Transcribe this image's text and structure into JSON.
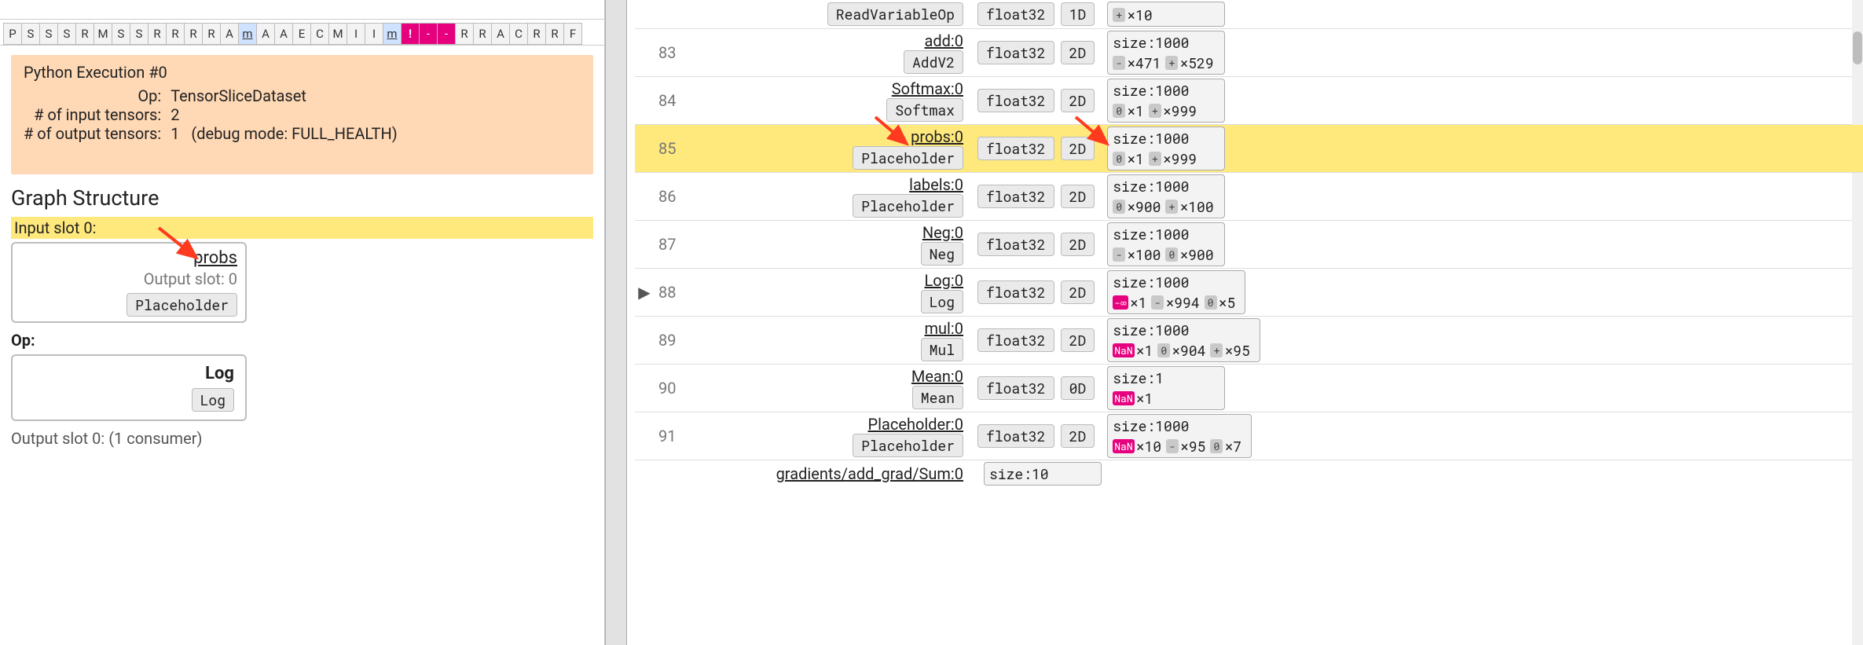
{
  "timeline": {
    "cells": [
      {
        "t": "P"
      },
      {
        "t": "S"
      },
      {
        "t": "S"
      },
      {
        "t": "S"
      },
      {
        "t": "R"
      },
      {
        "t": "M"
      },
      {
        "t": "S"
      },
      {
        "t": "S"
      },
      {
        "t": "R"
      },
      {
        "t": "R"
      },
      {
        "t": "R"
      },
      {
        "t": "R"
      },
      {
        "t": "A"
      },
      {
        "t": "m",
        "cls": "mtype"
      },
      {
        "t": "A"
      },
      {
        "t": "A"
      },
      {
        "t": "E"
      },
      {
        "t": "C"
      },
      {
        "t": "M"
      },
      {
        "t": "I"
      },
      {
        "t": "I"
      },
      {
        "t": "m",
        "cls": "mtype"
      },
      {
        "t": "!",
        "cls": "bang"
      },
      {
        "t": "-",
        "cls": "bang-minus"
      },
      {
        "t": "-",
        "cls": "bang-minus"
      },
      {
        "t": "R"
      },
      {
        "t": "R"
      },
      {
        "t": "A"
      },
      {
        "t": "C"
      },
      {
        "t": "R"
      },
      {
        "t": "R"
      },
      {
        "t": "F"
      }
    ]
  },
  "exec_card": {
    "title": "Python Execution #0",
    "op_label": "Op:",
    "op_value": "TensorSliceDataset",
    "in_label": "# of input tensors:",
    "in_value": "2",
    "out_label": "# of output tensors:",
    "out_value": "1",
    "debug_text": "(debug mode: FULL_HEALTH)"
  },
  "graph": {
    "title": "Graph Structure",
    "input_slot_label": "Input slot 0:",
    "probs_link": "probs",
    "probs_sub": "Output slot: 0",
    "placeholder_chip": "Placeholder",
    "op_label": "Op:",
    "op_name": "Log",
    "op_chip": "Log",
    "output_slot_line": "Output slot 0: (1 consumer)"
  },
  "rows": [
    {
      "idx": "",
      "name": "",
      "kind": "ReadVariableOp",
      "dtype": "float32",
      "rank": "1D",
      "size": "",
      "pills": [
        {
          "m": "+",
          "txt": "×10"
        }
      ],
      "topcut": true
    },
    {
      "idx": "83",
      "name": "add:0",
      "kind": "AddV2",
      "dtype": "float32",
      "rank": "2D",
      "size": "size:1000",
      "pills": [
        {
          "m": "-",
          "txt": "×471"
        },
        {
          "m": "+",
          "txt": "×529"
        }
      ]
    },
    {
      "idx": "84",
      "name": "Softmax:0",
      "kind": "Softmax",
      "dtype": "float32",
      "rank": "2D",
      "size": "size:1000",
      "pills": [
        {
          "m": "0",
          "txt": "×1"
        },
        {
          "m": "+",
          "txt": "×999"
        }
      ]
    },
    {
      "idx": "85",
      "name": "probs:0",
      "kind": "Placeholder",
      "dtype": "float32",
      "rank": "2D",
      "size": "size:1000",
      "pills": [
        {
          "m": "0",
          "txt": "×1"
        },
        {
          "m": "+",
          "txt": "×999"
        }
      ],
      "hl": true
    },
    {
      "idx": "86",
      "name": "labels:0",
      "kind": "Placeholder",
      "dtype": "float32",
      "rank": "2D",
      "size": "size:1000",
      "pills": [
        {
          "m": "0",
          "txt": "×900"
        },
        {
          "m": "+",
          "txt": "×100"
        }
      ]
    },
    {
      "idx": "87",
      "name": "Neg:0",
      "kind": "Neg",
      "dtype": "float32",
      "rank": "2D",
      "size": "size:1000",
      "pills": [
        {
          "m": "-",
          "txt": "×100"
        },
        {
          "m": "0",
          "txt": "×900"
        }
      ]
    },
    {
      "idx": "88",
      "name": "Log:0",
      "kind": "Log",
      "dtype": "float32",
      "rank": "2D",
      "size": "size:1000",
      "pills": [
        {
          "m": "-∞",
          "txt": "×1",
          "cls": "neginf"
        },
        {
          "m": "-",
          "txt": "×994"
        },
        {
          "m": "0",
          "txt": "×5"
        }
      ],
      "expand": true
    },
    {
      "idx": "89",
      "name": "mul:0",
      "kind": "Mul",
      "dtype": "float32",
      "rank": "2D",
      "size": "size:1000",
      "pills": [
        {
          "m": "NaN",
          "txt": "×1",
          "cls": "nan"
        },
        {
          "m": "0",
          "txt": "×904"
        },
        {
          "m": "+",
          "txt": "×95"
        }
      ]
    },
    {
      "idx": "90",
      "name": "Mean:0",
      "kind": "Mean",
      "dtype": "float32",
      "rank": "0D",
      "size": "size:1",
      "pills": [
        {
          "m": "NaN",
          "txt": "×1",
          "cls": "nan"
        }
      ]
    },
    {
      "idx": "91",
      "name": "Placeholder:0",
      "kind": "Placeholder",
      "dtype": "float32",
      "rank": "2D",
      "size": "size:1000",
      "pills": [
        {
          "m": "NaN",
          "txt": "×10",
          "cls": "nan"
        },
        {
          "m": "-",
          "txt": "×95"
        },
        {
          "m": "0",
          "txt": "×7"
        }
      ]
    },
    {
      "idx": "",
      "name": "gradients/add_grad/Sum:0",
      "kind": "",
      "dtype": "",
      "rank": "",
      "size": "size:10",
      "pills": [],
      "bottomcut": true
    }
  ]
}
